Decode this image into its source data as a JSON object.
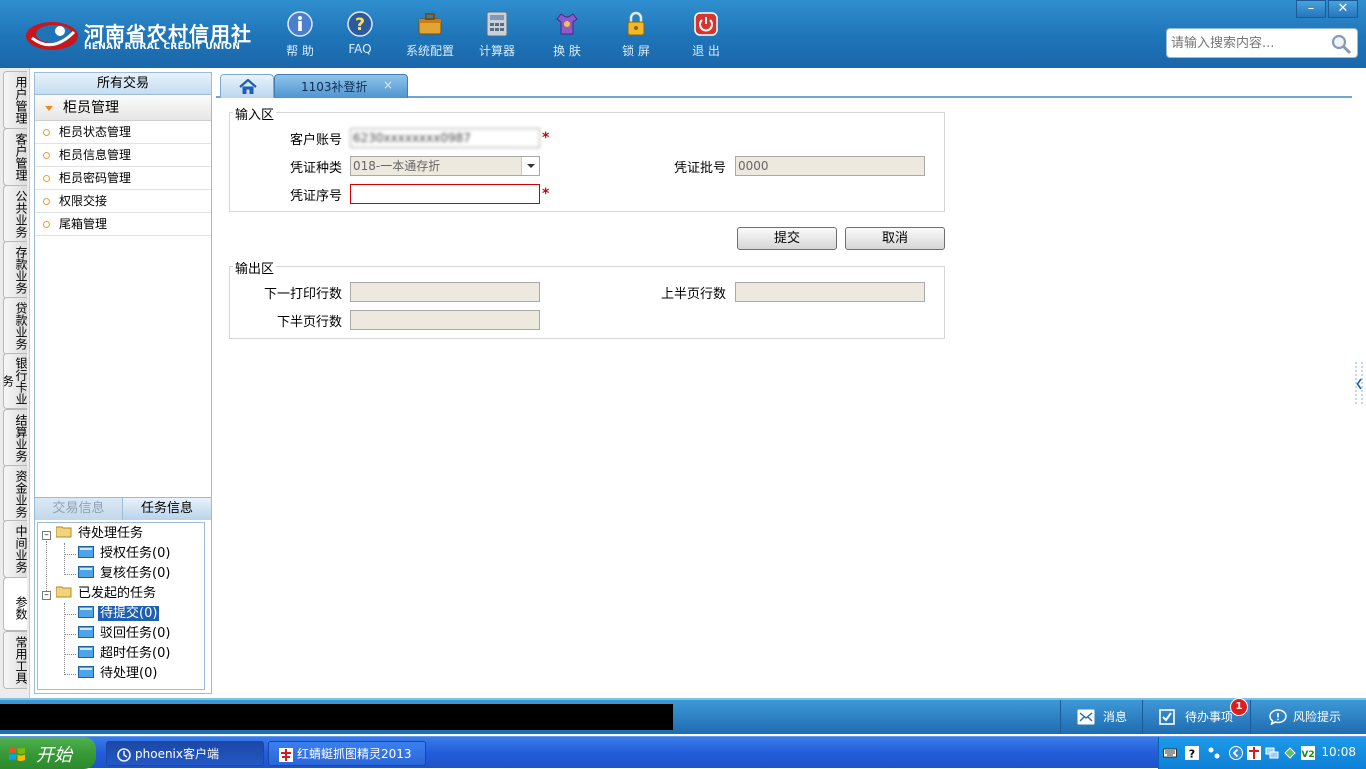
{
  "app": {
    "logo_cn": "河南省农村信用社",
    "logo_en": "HENAN RURAL CREDIT UNION",
    "window_minimize": "–",
    "window_close": "✕"
  },
  "toolbar": [
    {
      "label": "帮 助",
      "icon": "info-icon"
    },
    {
      "label": "FAQ",
      "icon": "help-icon"
    },
    {
      "label": "系统配置",
      "icon": "toolbox-icon"
    },
    {
      "label": "计算器",
      "icon": "calculator-icon"
    },
    {
      "label": "换 肤",
      "icon": "shirt-icon"
    },
    {
      "label": "锁 屏",
      "icon": "lock-icon"
    },
    {
      "label": "退 出",
      "icon": "power-icon"
    }
  ],
  "search": {
    "placeholder": "请输入搜索内容..."
  },
  "categories": [
    "用户管理",
    "客户管理",
    "公共业务",
    "存款业务",
    "贷款业务",
    "银行卡业务",
    "结算业务",
    "资金业务",
    "中间业务",
    "参数",
    "常用工具"
  ],
  "nav": {
    "title": "所有交易",
    "group": "柜员管理",
    "items": [
      "柜员状态管理",
      "柜员信息管理",
      "柜员密码管理",
      "权限交接",
      "尾箱管理"
    ]
  },
  "bottom_tabs": {
    "left": "交易信息",
    "right": "任务信息"
  },
  "tree": {
    "pending": "待处理任务",
    "pending_children": [
      "授权任务(0)",
      "复核任务(0)"
    ],
    "initiated": "已发起的任务",
    "initiated_children": [
      "待提交(0)",
      "驳回任务(0)",
      "超时任务(0)",
      "待处理(0)"
    ]
  },
  "tabs": {
    "active_label": "1103补登折",
    "close": "×"
  },
  "input_area": {
    "legend": "输入区",
    "account_label": "客户账号",
    "account_value": "",
    "voucher_type_label": "凭证种类",
    "voucher_type_value": "018-一本通存折",
    "voucher_batch_label": "凭证批号",
    "voucher_batch_value": "0000",
    "voucher_seq_label": "凭证序号",
    "voucher_seq_value": "",
    "required_mark": "*"
  },
  "buttons": {
    "submit": "提交",
    "cancel": "取消"
  },
  "output_area": {
    "legend": "输出区",
    "next_print_line_label": "下一打印行数",
    "upper_half_label": "上半页行数",
    "lower_half_label": "下半页行数"
  },
  "statusbar": {
    "messages": "消息",
    "todo": "待办事项",
    "todo_count": "1",
    "risk": "风险提示"
  },
  "taskbar": {
    "start": "开始",
    "items": [
      "phoenix客户端",
      "红蜻蜓抓图精灵2013"
    ],
    "clock": "10:08"
  },
  "colors": {
    "header": "#1f74b8",
    "accent_tab": "#4f94d0",
    "required": "#d00000",
    "selected": "#1d5fb0"
  }
}
